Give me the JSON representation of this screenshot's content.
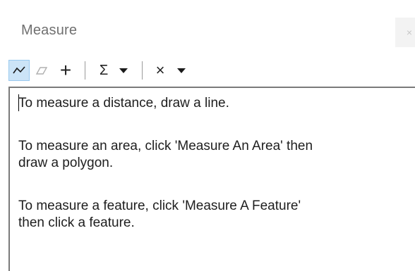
{
  "window": {
    "title": "Measure",
    "close_label": "×"
  },
  "toolbar": {
    "buttons": [
      {
        "name": "measure-line-button",
        "icon": "polyline-icon",
        "selected": true
      },
      {
        "name": "measure-area-button",
        "icon": "polygon-icon",
        "selected": false
      },
      {
        "name": "measure-feature-button",
        "icon": "plus-icon",
        "selected": false
      },
      {
        "name": "sum-dropdown",
        "icon": "sigma-icon",
        "selected": false
      },
      {
        "name": "clear-dropdown",
        "icon": "x-icon",
        "selected": false
      }
    ],
    "sigma_glyph": "Σ",
    "clear_glyph": "×",
    "plus_glyph": "+"
  },
  "content": {
    "line1": "To measure a distance, draw a line.",
    "line2a": "To measure an area, click 'Measure An Area' then",
    "line2b": "draw a polygon.",
    "line3a": "To measure a feature, click 'Measure A Feature'",
    "line3b": "then click a feature."
  }
}
